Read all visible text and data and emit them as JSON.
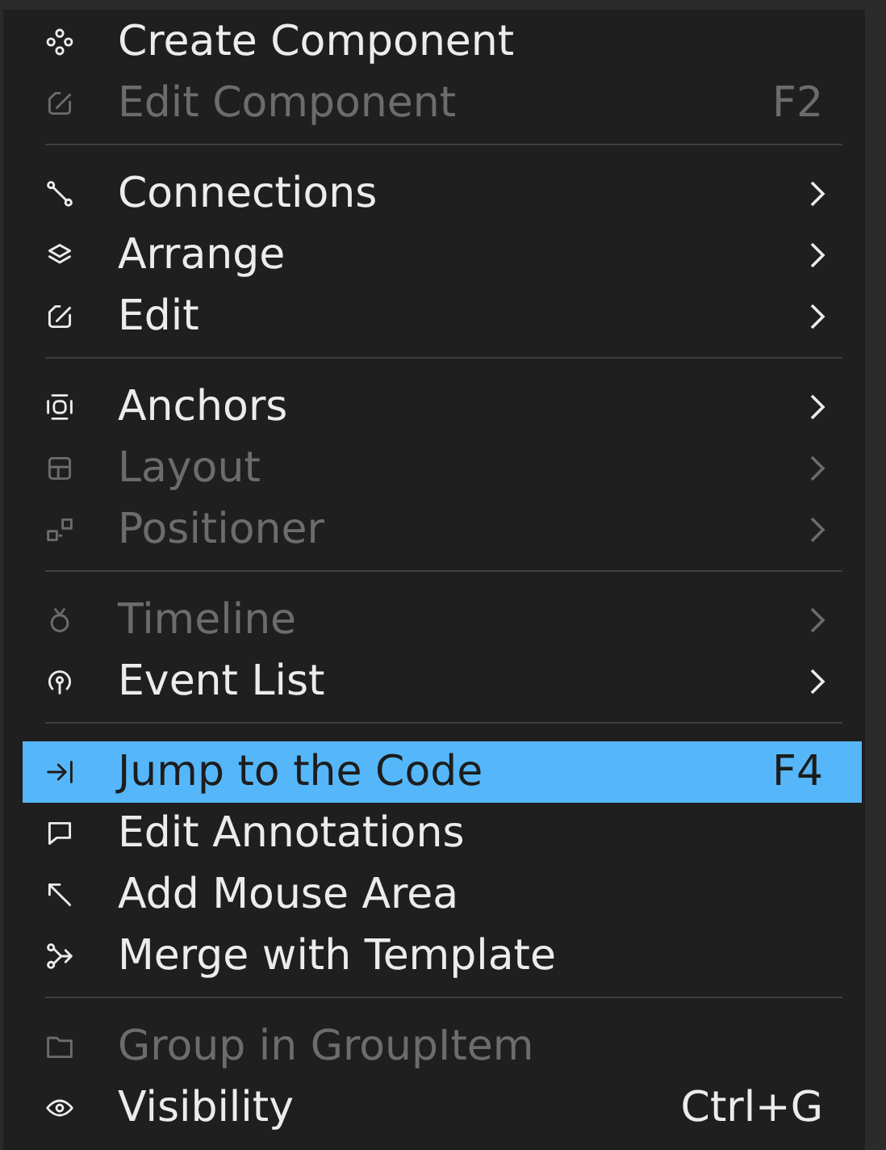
{
  "menu": {
    "groups": [
      {
        "items": [
          {
            "label": "Create Component",
            "disabled": false,
            "selected": false,
            "submenu": false
          },
          {
            "label": "Edit Component",
            "disabled": true,
            "selected": false,
            "submenu": false,
            "shortcut": "F2"
          }
        ]
      },
      {
        "items": [
          {
            "label": "Connections",
            "disabled": false,
            "selected": false,
            "submenu": true
          },
          {
            "label": "Arrange",
            "disabled": false,
            "selected": false,
            "submenu": true
          },
          {
            "label": "Edit",
            "disabled": false,
            "selected": false,
            "submenu": true
          }
        ]
      },
      {
        "items": [
          {
            "label": "Anchors",
            "disabled": false,
            "selected": false,
            "submenu": true
          },
          {
            "label": "Layout",
            "disabled": true,
            "selected": false,
            "submenu": true
          },
          {
            "label": "Positioner",
            "disabled": true,
            "selected": false,
            "submenu": true
          }
        ]
      },
      {
        "items": [
          {
            "label": "Timeline",
            "disabled": true,
            "selected": false,
            "submenu": true
          },
          {
            "label": "Event List",
            "disabled": false,
            "selected": false,
            "submenu": true
          }
        ]
      },
      {
        "items": [
          {
            "label": "Jump to the Code",
            "disabled": false,
            "selected": true,
            "submenu": false,
            "shortcut": "F4"
          },
          {
            "label": "Edit Annotations",
            "disabled": false,
            "selected": false,
            "submenu": false
          },
          {
            "label": "Add Mouse Area",
            "disabled": false,
            "selected": false,
            "submenu": false
          },
          {
            "label": "Merge with Template",
            "disabled": false,
            "selected": false,
            "submenu": false
          }
        ]
      },
      {
        "items": [
          {
            "label": "Group in GroupItem",
            "disabled": true,
            "selected": false,
            "submenu": false
          },
          {
            "label": "Visibility",
            "disabled": false,
            "selected": false,
            "submenu": false,
            "shortcut": "Ctrl+G"
          }
        ]
      }
    ]
  }
}
